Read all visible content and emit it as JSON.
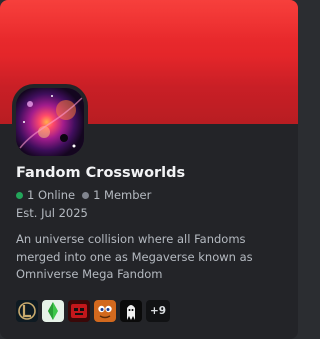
{
  "server": {
    "name": "Fandom Crossworlds",
    "online_label": "1 Online",
    "member_label": "1 Member",
    "established": "Est. Jul 2025",
    "description": "An universe collision where all Fandoms merged into one as Megaverse known as Omniverse Mega Fandom"
  },
  "colors": {
    "banner": "#e4262a",
    "card_background": "#232428",
    "online_dot": "#23a55a",
    "member_dot": "#80848e"
  },
  "emojis": [
    {
      "icon": "league-of-legends-logo-icon"
    },
    {
      "icon": "sims-plumbob-icon"
    },
    {
      "icon": "red-robot-face-icon"
    },
    {
      "icon": "orange-cartoon-face-icon"
    },
    {
      "icon": "white-dark-creature-icon"
    }
  ],
  "emoji_more_label": "+9"
}
